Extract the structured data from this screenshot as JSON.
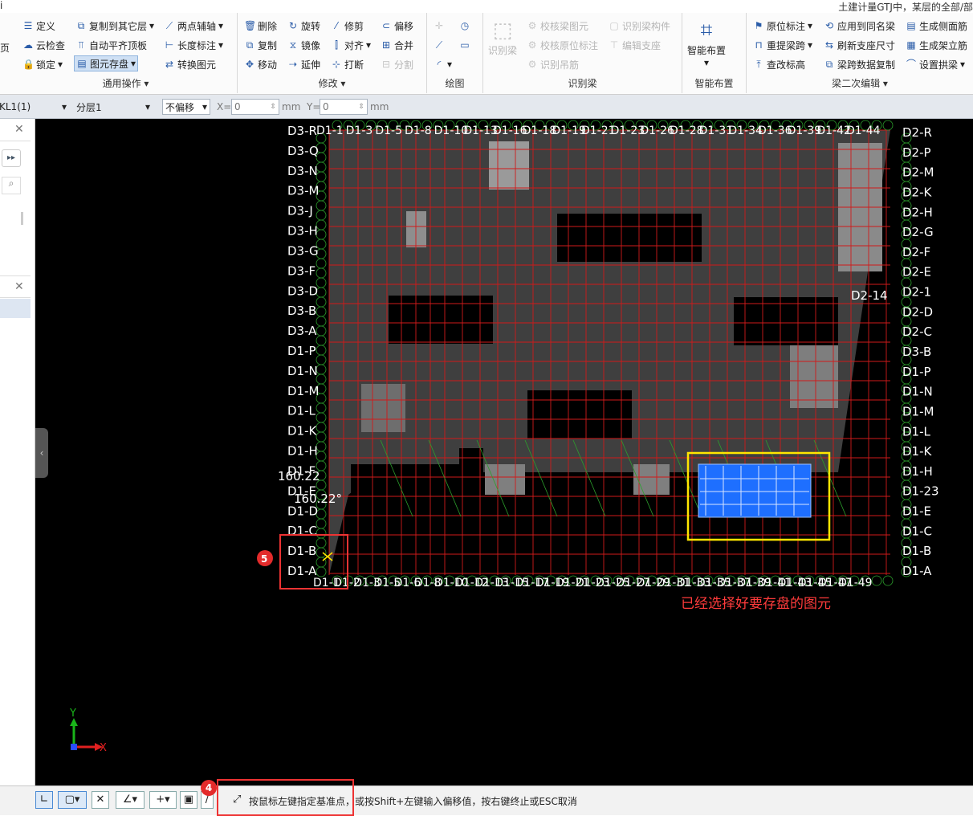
{
  "titlebar": {
    "left_text": "i",
    "right_text": "土建计量GTJ中，某层的全部/部"
  },
  "ribbon": {
    "general_ops": {
      "label": "通用操作",
      "items": [
        "定义",
        "云检查",
        "锁定",
        "复制到其它层",
        "自动平齐顶板",
        "图元存盘",
        "两点辅轴",
        "长度标注",
        "转换图元"
      ]
    },
    "modify": {
      "label": "修改",
      "items": [
        "删除",
        "旋转",
        "修剪",
        "偏移",
        "复制",
        "镜像",
        "对齐",
        "合并",
        "移动",
        "延伸",
        "打断",
        "分割"
      ]
    },
    "draw": {
      "label": "绘图"
    },
    "identify_beam": {
      "label": "识别梁",
      "big": "识别梁",
      "items": [
        "校核梁图元",
        "识别梁构件",
        "校核原位标注",
        "编辑支座",
        "识别吊筋"
      ]
    },
    "smart_layout": {
      "label": "智能布置",
      "big": "智能布置"
    },
    "beam_edit": {
      "label": "梁二次编辑",
      "items": [
        "原位标注",
        "应用到同名梁",
        "生成侧面筋",
        "重提梁跨",
        "刷新支座尺寸",
        "生成架立筋",
        "查改标高",
        "梁跨数据复制",
        "设置拱梁"
      ]
    },
    "left_edge": "页"
  },
  "toolbar2": {
    "element": "KL1(1)",
    "layer": "分层1",
    "offset_mode": "不偏移",
    "x_label": "X=",
    "x_value": "0",
    "y_label": "Y=",
    "y_value": "0",
    "unit": "mm"
  },
  "canvas": {
    "annotation": "已经选择好要存盘的图元",
    "angle_label": "160.22°",
    "angle_label2": "160.22",
    "label_d2_14": "D2-14",
    "left_axis_labels": [
      "D3-R",
      "D3-Q",
      "D3-N",
      "D3-M",
      "D3-J",
      "D3-H",
      "D3-G",
      "D3-F",
      "D3-D",
      "D3-B",
      "D3-A",
      "D1-P",
      "D1-N",
      "D1-M",
      "D1-L",
      "D1-K",
      "D1-H",
      "D1-F",
      "D1-E",
      "D1-D",
      "D1-C",
      "D1-B",
      "D1-A"
    ],
    "right_axis_labels": [
      "D2-R",
      "D2-P",
      "D2-M",
      "D2-K",
      "D2-H",
      "D2-G",
      "D2-F",
      "D2-E",
      "D2-1",
      "D2-D",
      "D2-C",
      "D3-B",
      "D1-P",
      "D1-N",
      "D1-M",
      "D1-L",
      "D1-K",
      "D1-H",
      "D1-23",
      "D1-E",
      "D1-C",
      "D1-B",
      "D1-A"
    ],
    "bottom_axis_labels": [
      "D1-1",
      "D1-2",
      "D1-3",
      "D1-5",
      "D1-6",
      "D1-8",
      "D1-10",
      "D1-12",
      "D1-13",
      "D1-15",
      "D1-17",
      "D1-19",
      "D1-21",
      "D1-23",
      "D1-25",
      "D1-27",
      "D1-29",
      "D1-31",
      "D1-33",
      "D1-35",
      "D1-37",
      "D1-39",
      "D1-41",
      "D1-43",
      "D1-45",
      "D1-47",
      "D1-49"
    ],
    "top_axis_labels": [
      "D1-1",
      "D1-3",
      "D1-5",
      "D1-8",
      "D1-10",
      "D1-13",
      "D1-16",
      "D1-18",
      "D1-19",
      "D1-21",
      "D1-23",
      "D1-26",
      "D1-28",
      "D1-31",
      "D1-34",
      "D1-36",
      "D1-39",
      "D1-42",
      "D1-44"
    ],
    "badge5": "5",
    "axis_x": "X",
    "axis_y": "Y"
  },
  "status": {
    "badge4": "4",
    "prompt": "按鼠标左键指定基准点，或按Shift+左键输入偏移值，按右键终止或ESC取消"
  },
  "colors": {
    "grid": "#d01a1a",
    "highlight": "#ffe600",
    "selection": "#1e6fff",
    "annotation": "#ff3b3b",
    "axis_circle": "#2ca02c"
  }
}
